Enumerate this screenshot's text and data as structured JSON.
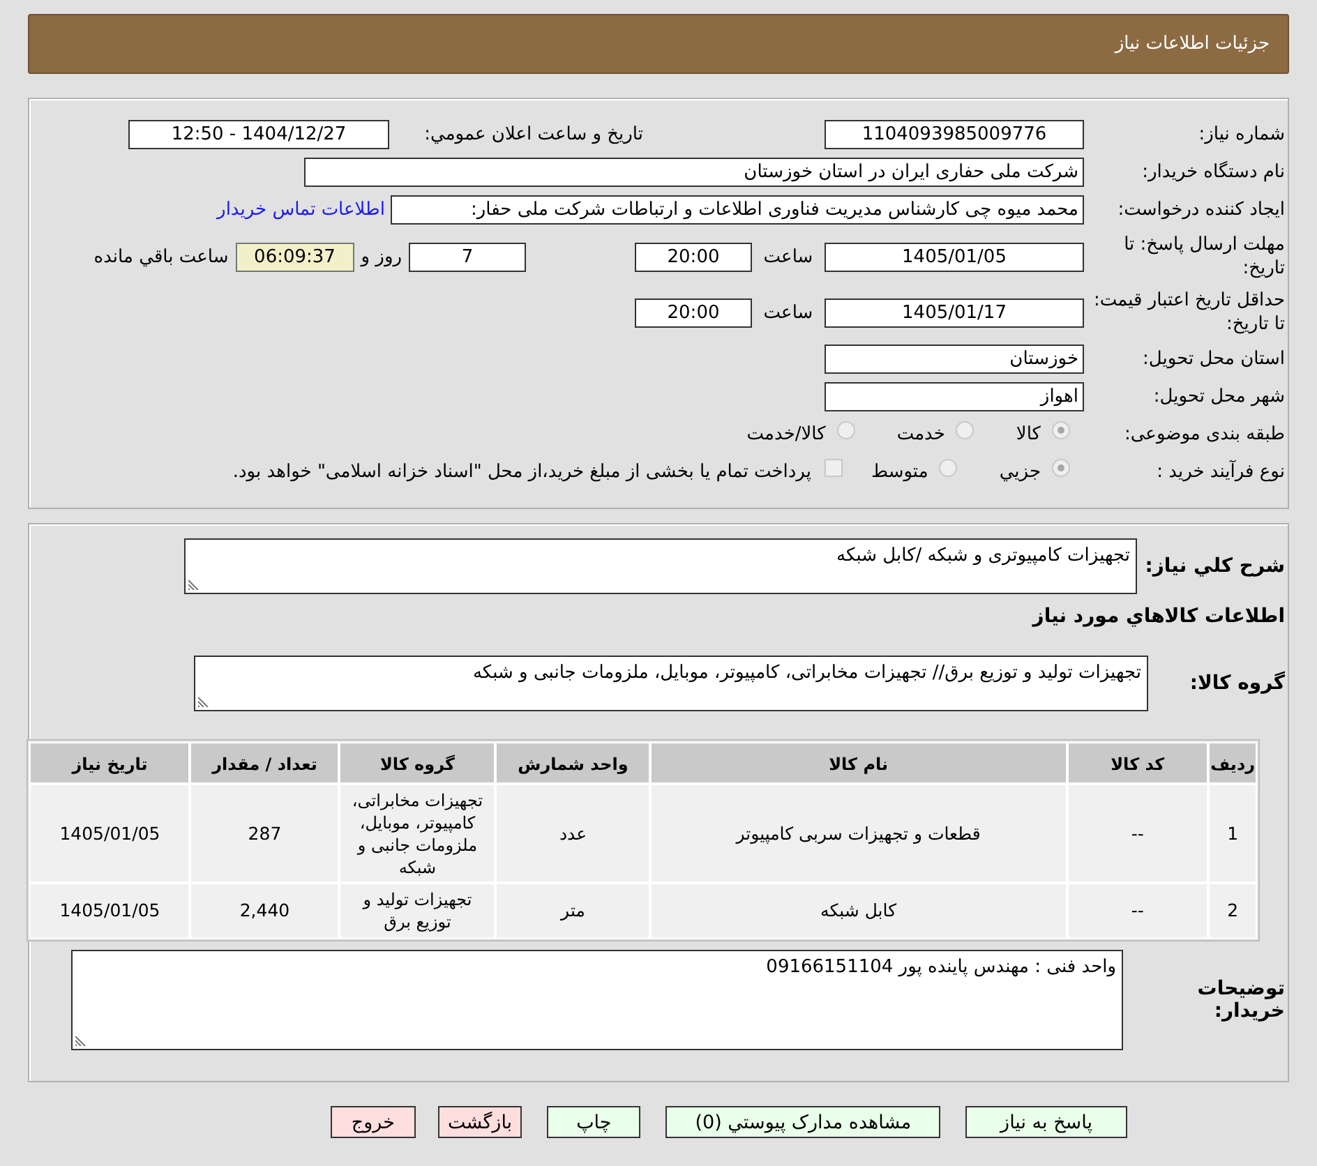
{
  "header": {
    "title": "جزئیات اطلاعات نیاز"
  },
  "need_number": {
    "label": "شماره نیاز:",
    "value": "1104093985009776"
  },
  "announce": {
    "label": "تاریخ و ساعت اعلان عمومي:",
    "value": "1404/12/27 - 12:50"
  },
  "buyer": {
    "label": "نام دستگاه خریدار:",
    "value": "شرکت ملی حفاری ایران در استان خوزستان"
  },
  "creator": {
    "label": "ایجاد کننده درخواست:",
    "value": "محمد میوه چی کارشناس مدیریت فناوری اطلاعات و ارتباطات  شرکت ملی حفار:",
    "link": "اطلاعات تماس خریدار"
  },
  "deadline": {
    "label": "مهلت ارسال پاسخ: تا تاریخ:",
    "date": "1405/01/05",
    "time_label": "ساعت",
    "time": "20:00",
    "days": "7",
    "days_label": "روز و",
    "remaining": "06:09:37",
    "remaining_label": "ساعت باقي مانده"
  },
  "validity": {
    "label": "حداقل تاریخ اعتبار قیمت: تا تاریخ:",
    "date": "1405/01/17",
    "time_label": "ساعت",
    "time": "20:00"
  },
  "province": {
    "label": "استان محل تحویل:",
    "value": "خوزستان"
  },
  "city": {
    "label": "شهر محل تحویل:",
    "value": "اهواز"
  },
  "category": {
    "label": "طبقه بندی موضوعی:",
    "options": [
      {
        "label": "کالا",
        "selected": true
      },
      {
        "label": "خدمت",
        "selected": false
      },
      {
        "label": "کالا/خدمت",
        "selected": false
      }
    ]
  },
  "process": {
    "label": "نوع فرآیند خرید :",
    "options": [
      {
        "label": "جزيي",
        "selected": true
      },
      {
        "label": "متوسط",
        "selected": false
      }
    ],
    "payment": {
      "label": "پرداخت تمام یا بخشی از مبلغ خرید،از محل \"اسناد خزانه اسلامی\" خواهد بود.",
      "checked": false
    }
  },
  "description": {
    "label": "شرح کلي نیاز:",
    "value": "تجهیزات کامپیوتری و شبکه /کابل شبکه"
  },
  "goods_heading": "اطلاعات کالاهاي مورد نیاز",
  "goods_group": {
    "label": "گروه کالا:",
    "value": "تجهیزات تولید و توزیع برق// تجهیزات مخابراتی، کامپیوتر، موبایل، ملزومات جانبی و شبکه"
  },
  "table": {
    "columns": [
      "ردیف",
      "کد کالا",
      "نام کالا",
      "واحد شمارش",
      "گروه کالا",
      "تعداد / مقدار",
      "تاریخ نیاز"
    ],
    "rows": [
      [
        "1",
        "--",
        "قطعات و تجهیزات سربی کامپیوتر",
        "عدد",
        "تجهیزات مخابراتی، کامپیوتر، موبایل، ملزومات جانبی و شبکه",
        "287",
        "1405/01/05"
      ],
      [
        "2",
        "--",
        "کابل شبکه",
        "متر",
        "تجهیزات تولید و توزیع برق",
        "2,440",
        "1405/01/05"
      ]
    ]
  },
  "notes": {
    "label": "توضیحات خریدار:",
    "value": "واحد فنی : مهندس پاینده پور 09166151104"
  },
  "buttons": [
    {
      "label": "پاسخ به نیاز",
      "kind": "action"
    },
    {
      "label": "مشاهده مدارک پیوستي (0)",
      "kind": "action"
    },
    {
      "label": "چاپ",
      "kind": "action"
    },
    {
      "label": "بازگشت",
      "kind": "exit"
    },
    {
      "label": "خروج",
      "kind": "exit"
    }
  ]
}
